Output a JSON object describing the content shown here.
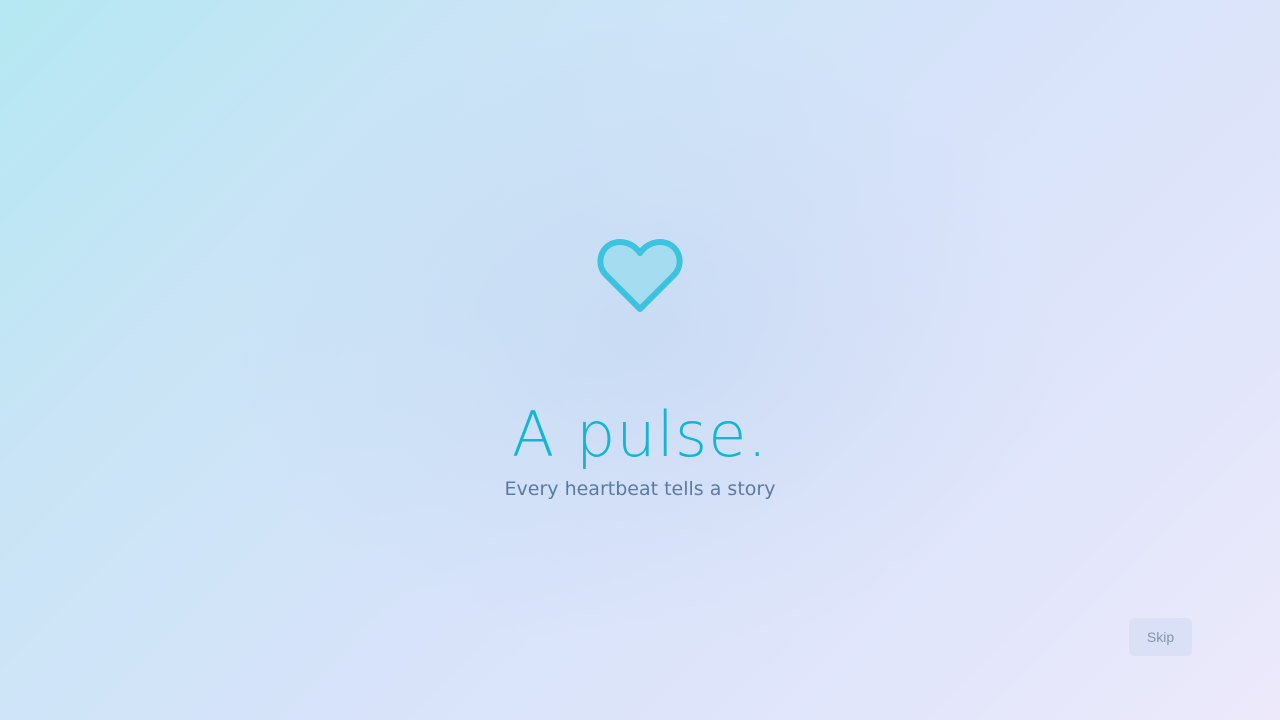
{
  "splash": {
    "icon": "heart-icon",
    "title": "A pulse.",
    "subtitle": "Every heartbeat tells a story"
  },
  "actions": {
    "skip_label": "Skip"
  },
  "colors": {
    "accent": "#12b5d3",
    "heart_stroke": "#3cc3df",
    "heart_fill": "#a6dcef",
    "subtitle": "#5a7aa8"
  }
}
